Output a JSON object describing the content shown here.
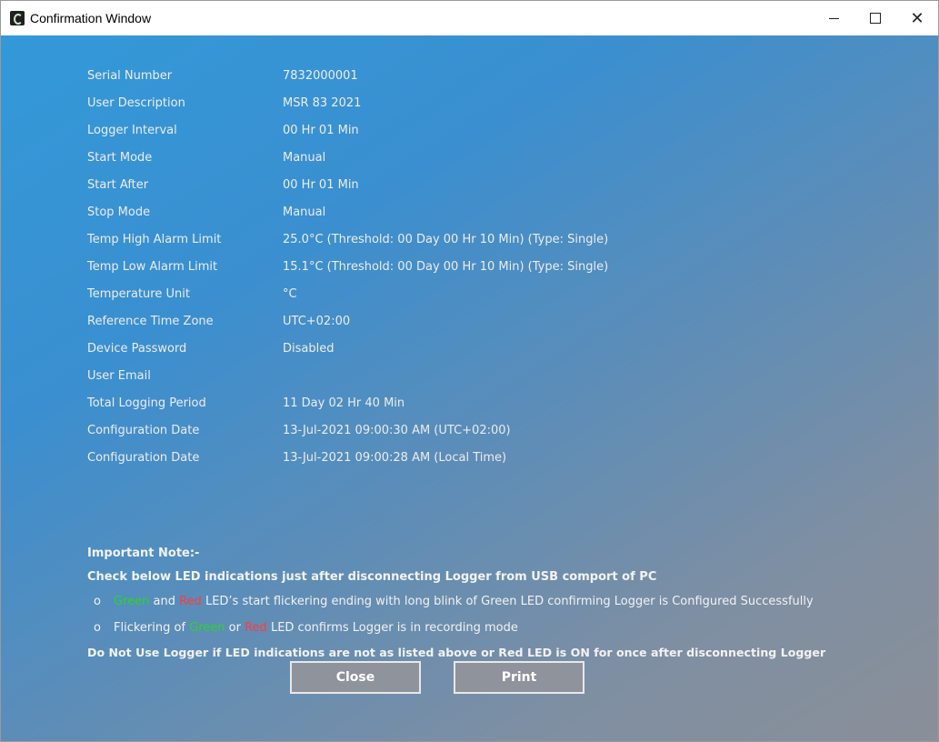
{
  "window": {
    "title": "Confirmation Window",
    "minimize": "—",
    "maximize": "☐",
    "close": "✕"
  },
  "details": [
    {
      "label": "Serial Number",
      "value": "7832000001"
    },
    {
      "label": "User Description",
      "value": "MSR 83 2021"
    },
    {
      "label": "Logger Interval",
      "value": "00 Hr 01 Min"
    },
    {
      "label": "Start Mode",
      "value": "Manual"
    },
    {
      "label": "Start After",
      "value": "00 Hr 01 Min"
    },
    {
      "label": "Stop Mode",
      "value": "Manual"
    },
    {
      "label": "Temp High Alarm Limit",
      "value": "25.0°C (Threshold: 00 Day 00 Hr 10 Min) (Type: Single)"
    },
    {
      "label": "Temp Low Alarm Limit",
      "value": "15.1°C (Threshold: 00 Day 00 Hr 10 Min) (Type: Single)"
    },
    {
      "label": "Temperature Unit",
      "value": "°C"
    },
    {
      "label": "Reference Time Zone",
      "value": "UTC+02:00"
    },
    {
      "label": "Device Password",
      "value": "Disabled"
    },
    {
      "label": "User Email",
      "value": ""
    },
    {
      "label": "Total Logging Period",
      "value": "11 Day 02 Hr 40 Min"
    },
    {
      "label": "Configuration Date",
      "value": "13-Jul-2021 09:00:30 AM (UTC+02:00)"
    },
    {
      "label": "Configuration Date",
      "value": "13-Jul-2021 09:00:28 AM (Local Time)"
    }
  ],
  "note": {
    "heading": "Important Note:-",
    "instruction": "Check below LED indications just after disconnecting Logger from USB comport of PC",
    "bullet1": {
      "marker": "o",
      "green": "Green",
      "and": " and ",
      "red": "Red",
      "rest": " LED’s start flickering ending with long blink of Green LED confirming Logger is Configured Successfully"
    },
    "bullet2": {
      "marker": "o",
      "prefix": "Flickering of ",
      "green": "Green",
      "or": " or ",
      "red": "Red",
      "rest": " LED confirms Logger is in recording mode"
    },
    "warning": "Do Not Use Logger if LED indications are not as listed above or Red LED is ON for once after disconnecting Logger"
  },
  "buttons": {
    "close": "Close",
    "print": "Print"
  }
}
